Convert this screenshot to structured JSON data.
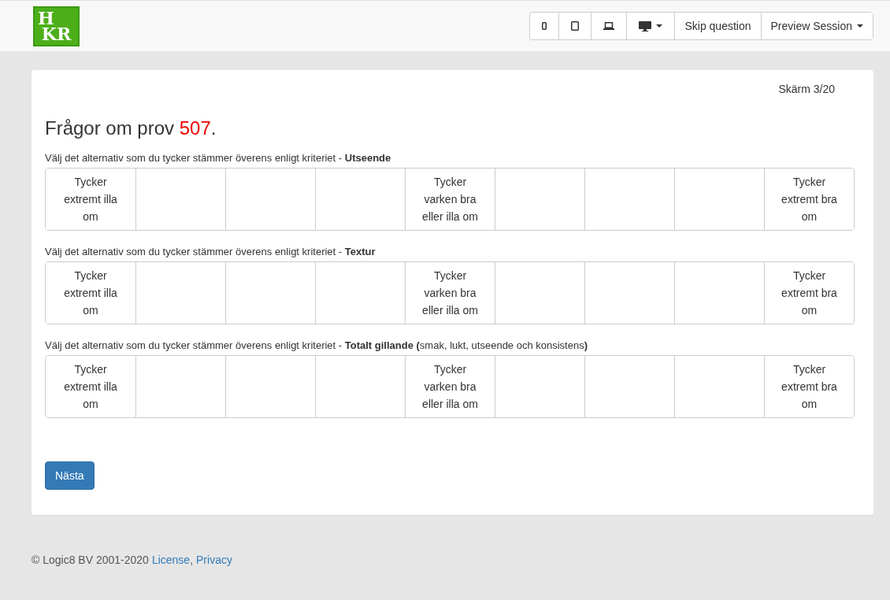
{
  "logo": {
    "lines": [
      "H",
      "KR"
    ]
  },
  "toolbar": {
    "devices": [
      {
        "kind": "phone",
        "caret": false
      },
      {
        "kind": "tablet",
        "caret": false
      },
      {
        "kind": "laptop",
        "caret": false
      },
      {
        "kind": "desktop",
        "caret": true
      }
    ],
    "buttons": [
      {
        "label": "Skip question",
        "caret": false
      },
      {
        "label": "Preview Session",
        "caret": true
      }
    ]
  },
  "screen_counter": "Skärm 3/20",
  "heading": {
    "prefix": "Frågor om prov",
    "number": "507",
    "suffix": "."
  },
  "questions": [
    {
      "prompt": "Välj det alternativ som du tycker stämmer överens enligt kriteriet - **Utseende**",
      "options": [
        {
          "label": "Tycker extremt illa om",
          "selected": false
        },
        {
          "selected": false
        },
        {
          "selected": false
        },
        {
          "selected": false
        },
        {
          "label": "Tycker varken bra eller illa om",
          "selected": false
        },
        {
          "selected": false
        },
        {
          "selected": false
        },
        {
          "selected": false
        },
        {
          "label": "Tycker extremt bra om",
          "selected": false
        }
      ]
    },
    {
      "prompt": "Välj det alternativ som du tycker stämmer överens enligt kriteriet - **Textur**",
      "options": [
        {
          "label": "Tycker extremt illa om",
          "selected": false
        },
        {
          "selected": false
        },
        {
          "selected": false
        },
        {
          "selected": false
        },
        {
          "label": "Tycker varken bra eller illa om",
          "selected": false
        },
        {
          "selected": false
        },
        {
          "selected": false
        },
        {
          "selected": false
        },
        {
          "label": "Tycker extremt bra om",
          "selected": false
        }
      ]
    },
    {
      "prompt": "Välj det alternativ som du tycker stämmer överens enligt kriteriet - **Totalt gillande (**smak, lukt, utseende och konsistens**)**",
      "options": [
        {
          "label": "Tycker extremt illa om",
          "selected": false
        },
        {
          "selected": false
        },
        {
          "selected": false
        },
        {
          "selected": false
        },
        {
          "label": "Tycker varken bra eller illa om",
          "selected": false
        },
        {
          "selected": false
        },
        {
          "selected": false
        },
        {
          "selected": false
        },
        {
          "label": "Tycker extremt bra om",
          "selected": false
        }
      ]
    }
  ],
  "next_button": "Nästa",
  "footer": {
    "copyright": "© Logic8 BV 2001-2020",
    "links": [
      "License",
      "Privacy"
    ],
    "separator": ","
  }
}
